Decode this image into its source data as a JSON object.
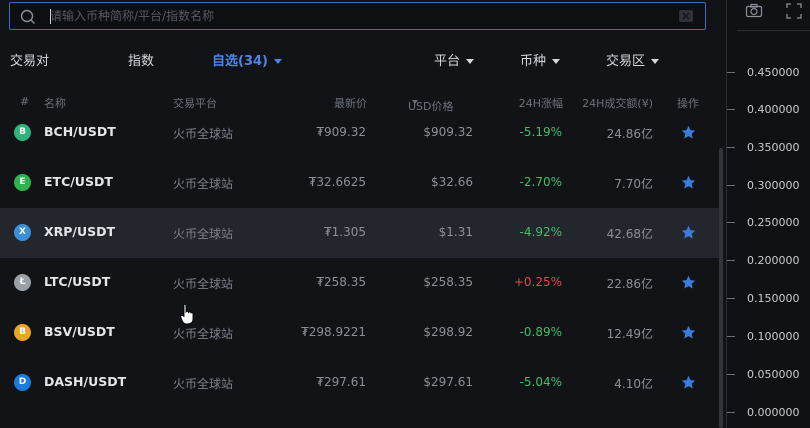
{
  "search": {
    "placeholder": "请输入币种简称/平台/指数名称"
  },
  "filters": {
    "pairs": "交易对",
    "index": "指数",
    "favorites": "自选(34)",
    "platform": "平台",
    "coin": "币种",
    "zone": "交易区"
  },
  "columns": {
    "num": "#",
    "name": "名称",
    "platform": "交易平台",
    "price": "最新价",
    "usd": "USD价格",
    "change": "24H涨幅",
    "volume": "24H成交额(¥)",
    "action": "操作"
  },
  "rows": [
    {
      "icon": "bch-icon",
      "symbol": "B",
      "color": "#2fb37c",
      "pair": "BCH/USDT",
      "platform": "火币全球站",
      "price": "₮909.32",
      "usd": "$909.32",
      "change": "-5.19%",
      "change_color": "#3fbf68",
      "volume": "24.86亿"
    },
    {
      "icon": "etc-icon",
      "symbol": "E",
      "color": "#2fb34c",
      "pair": "ETC/USDT",
      "platform": "火币全球站",
      "price": "₮32.6625",
      "usd": "$32.66",
      "change": "-2.70%",
      "change_color": "#3fbf68",
      "volume": "7.70亿"
    },
    {
      "icon": "xrp-icon",
      "symbol": "X",
      "color": "#3a8fd6",
      "pair": "XRP/USDT",
      "platform": "火币全球站",
      "price": "₮1.305",
      "usd": "$1.31",
      "change": "-4.92%",
      "change_color": "#3fbf68",
      "volume": "42.68亿"
    },
    {
      "icon": "ltc-icon",
      "symbol": "Ł",
      "color": "#9aa0a8",
      "pair": "LTC/USDT",
      "platform": "火币全球站",
      "price": "₮258.35",
      "usd": "$258.35",
      "change": "+0.25%",
      "change_color": "#e04848",
      "volume": "22.86亿"
    },
    {
      "icon": "bsv-icon",
      "symbol": "B",
      "color": "#e8a723",
      "pair": "BSV/USDT",
      "platform": "火币全球站",
      "price": "₮298.9221",
      "usd": "$298.92",
      "change": "-0.89%",
      "change_color": "#3fbf68",
      "volume": "12.49亿"
    },
    {
      "icon": "dash-icon",
      "symbol": "D",
      "color": "#1d7bd9",
      "pair": "DASH/USDT",
      "platform": "火币全球站",
      "price": "₮297.61",
      "usd": "$297.61",
      "change": "-5.04%",
      "change_color": "#3fbf68",
      "volume": "4.10亿"
    }
  ],
  "axis": {
    "ticks": [
      "0.450000",
      "0.400000",
      "0.350000",
      "0.300000",
      "0.250000",
      "0.200000",
      "0.150000",
      "0.100000",
      "0.050000",
      "0.000000"
    ]
  },
  "colors": {
    "accent": "#4d86e8",
    "star": "#3b7ddd"
  }
}
